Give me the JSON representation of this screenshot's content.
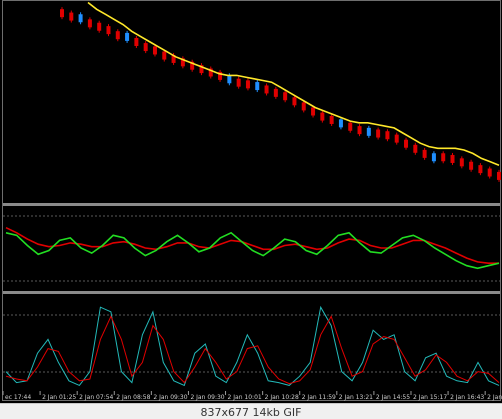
{
  "colors": {
    "background": "#000000",
    "frame": "#6e6e6e",
    "separator": "#8a8a8a",
    "grid_dash": "#5a5a5a",
    "bear_candle": "#e00000",
    "bull_candle": "#1f8fff",
    "moving_average": "#ffe82a",
    "oscillator_fast": "#22dd22",
    "oscillator_slow": "#e00000",
    "stochastic_main": "#23b9b9",
    "stochastic_signal": "#e00000",
    "tick_text": "#d0d0d0",
    "caption_bg": "#f0f0f0"
  },
  "caption": {
    "text": "837x677  14kb  GIF"
  },
  "chart_data": [
    {
      "type": "line",
      "panel": "price",
      "description_of_visual": "descending candlestick series with overlaid moving average",
      "candles_trend": "falling",
      "series": [
        {
          "role": "moving_average",
          "color": "#ffe82a",
          "y": [
            100,
            96,
            93,
            90,
            87,
            83,
            80,
            77,
            74,
            71,
            68,
            66,
            64,
            62,
            60,
            58,
            57,
            57,
            56,
            55,
            54,
            53,
            50,
            47,
            44,
            41,
            38,
            36,
            34,
            32,
            30,
            29,
            29,
            28,
            27,
            26,
            23,
            20,
            17,
            15,
            14,
            14,
            14,
            13,
            11,
            8,
            6,
            4
          ]
        }
      ],
      "candles": [
        {
          "c": 99,
          "bull": false
        },
        {
          "c": 97,
          "bull": false
        },
        {
          "c": 96,
          "bull": true
        },
        {
          "c": 93,
          "bull": false
        },
        {
          "c": 91,
          "bull": false
        },
        {
          "c": 89,
          "bull": false
        },
        {
          "c": 86,
          "bull": false
        },
        {
          "c": 85,
          "bull": true
        },
        {
          "c": 82,
          "bull": false
        },
        {
          "c": 79,
          "bull": false
        },
        {
          "c": 77,
          "bull": false
        },
        {
          "c": 74,
          "bull": false
        },
        {
          "c": 72,
          "bull": false
        },
        {
          "c": 70,
          "bull": false
        },
        {
          "c": 68,
          "bull": false
        },
        {
          "c": 66,
          "bull": false
        },
        {
          "c": 64,
          "bull": false
        },
        {
          "c": 62,
          "bull": false
        },
        {
          "c": 60,
          "bull": true
        },
        {
          "c": 58,
          "bull": false
        },
        {
          "c": 57,
          "bull": false
        },
        {
          "c": 56,
          "bull": true
        },
        {
          "c": 54,
          "bull": false
        },
        {
          "c": 52,
          "bull": false
        },
        {
          "c": 50,
          "bull": false
        },
        {
          "c": 47,
          "bull": false
        },
        {
          "c": 44,
          "bull": false
        },
        {
          "c": 41,
          "bull": false
        },
        {
          "c": 38,
          "bull": false
        },
        {
          "c": 36,
          "bull": false
        },
        {
          "c": 34,
          "bull": true
        },
        {
          "c": 32,
          "bull": false
        },
        {
          "c": 30,
          "bull": false
        },
        {
          "c": 29,
          "bull": true
        },
        {
          "c": 28,
          "bull": false
        },
        {
          "c": 27,
          "bull": false
        },
        {
          "c": 25,
          "bull": false
        },
        {
          "c": 22,
          "bull": false
        },
        {
          "c": 19,
          "bull": false
        },
        {
          "c": 16,
          "bull": false
        },
        {
          "c": 14,
          "bull": true
        },
        {
          "c": 14,
          "bull": false
        },
        {
          "c": 13,
          "bull": false
        },
        {
          "c": 11,
          "bull": false
        },
        {
          "c": 9,
          "bull": false
        },
        {
          "c": 7,
          "bull": false
        },
        {
          "c": 5,
          "bull": false
        },
        {
          "c": 3,
          "bull": false
        }
      ],
      "ylim": [
        0,
        105
      ]
    },
    {
      "type": "line",
      "panel": "oscillator",
      "series": [
        {
          "role": "fast",
          "color": "#22dd22",
          "y": [
            62,
            60,
            52,
            45,
            48,
            56,
            58,
            50,
            46,
            52,
            60,
            58,
            50,
            44,
            48,
            55,
            60,
            54,
            47,
            50,
            58,
            62,
            55,
            48,
            44,
            50,
            57,
            55,
            48,
            45,
            52,
            60,
            62,
            54,
            47,
            46,
            52,
            58,
            60,
            56,
            50,
            45,
            40,
            36,
            34,
            36,
            38
          ]
        },
        {
          "role": "slow",
          "color": "#e00000",
          "y": [
            66,
            62,
            57,
            53,
            51,
            52,
            54,
            53,
            51,
            51,
            54,
            55,
            53,
            50,
            49,
            51,
            54,
            54,
            51,
            50,
            53,
            56,
            55,
            52,
            49,
            49,
            52,
            53,
            51,
            49,
            50,
            54,
            57,
            56,
            52,
            50,
            50,
            53,
            56,
            56,
            53,
            50,
            46,
            42,
            39,
            38,
            38
          ]
        }
      ],
      "ylim": [
        20,
        80
      ]
    },
    {
      "type": "line",
      "panel": "stochastic",
      "series": [
        {
          "role": "main",
          "color": "#23b9b9",
          "y": [
            20,
            8,
            10,
            40,
            55,
            30,
            10,
            5,
            20,
            90,
            85,
            20,
            8,
            60,
            85,
            30,
            10,
            5,
            40,
            50,
            15,
            8,
            30,
            60,
            40,
            10,
            8,
            5,
            15,
            30,
            90,
            70,
            20,
            10,
            30,
            65,
            55,
            60,
            20,
            10,
            35,
            40,
            15,
            10,
            8,
            30,
            10,
            5
          ]
        },
        {
          "role": "signal",
          "color": "#e00000",
          "y": [
            15,
            12,
            10,
            25,
            45,
            42,
            20,
            10,
            12,
            55,
            80,
            55,
            15,
            30,
            70,
            55,
            20,
            8,
            25,
            45,
            30,
            12,
            20,
            45,
            48,
            25,
            12,
            7,
            10,
            22,
            60,
            80,
            45,
            15,
            20,
            50,
            58,
            55,
            35,
            15,
            22,
            38,
            30,
            15,
            10,
            20,
            18,
            8
          ]
        }
      ],
      "levels": [
        20,
        80
      ],
      "ylim": [
        0,
        100
      ]
    }
  ],
  "time_labels": [
    "ec 17:44",
    "2 Jan 01:25",
    "2 Jan 07:54",
    "2 Jan 08:58",
    "2 Jan 09:30",
    "2 Jan 09:30",
    "2 Jan 10:01",
    "2 Jan 10:28",
    "2 Jan 11:59",
    "2 Jan 13:21",
    "2 Jan 14:55",
    "2 Jan 15:17",
    "2 Jan 16:43",
    "2 Jan"
  ]
}
